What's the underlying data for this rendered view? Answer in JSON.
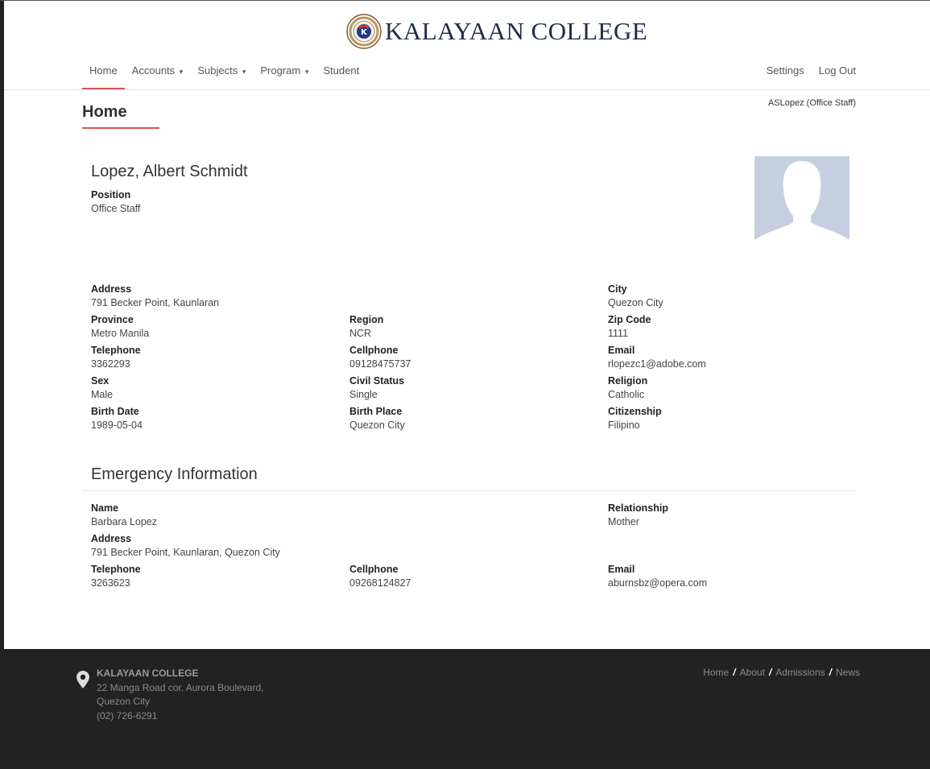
{
  "brand": {
    "name": "KALAYAAN COLLEGE",
    "logo_icon": "college-seal-logo"
  },
  "nav": {
    "left": [
      {
        "label": "Home",
        "active": true,
        "dropdown": false
      },
      {
        "label": "Accounts",
        "active": false,
        "dropdown": true
      },
      {
        "label": "Subjects",
        "active": false,
        "dropdown": true
      },
      {
        "label": "Program",
        "active": false,
        "dropdown": true
      },
      {
        "label": "Student",
        "active": false,
        "dropdown": false
      }
    ],
    "right": [
      {
        "label": "Settings"
      },
      {
        "label": "Log Out"
      }
    ],
    "dropdown_caret": "▾"
  },
  "user_tag": "ASLopez (Office Staff)",
  "page_title": "Home",
  "profile": {
    "name": "Lopez, Albert Schmidt",
    "position_label": "Position",
    "position": "Office Staff",
    "avatar_icon": "default-avatar-silhouette",
    "fields": [
      {
        "label": "Address",
        "value": "791 Becker Point, Kaunlaran"
      },
      {
        "label": "City",
        "value": "Quezon City"
      },
      {
        "label": "Province",
        "value": "Metro Manila"
      },
      {
        "label": "Region",
        "value": "NCR"
      },
      {
        "label": "Zip Code",
        "value": "1111"
      },
      {
        "label": "Telephone",
        "value": "3362293"
      },
      {
        "label": "Cellphone",
        "value": "09128475737"
      },
      {
        "label": "Email",
        "value": "rlopezc1@adobe.com"
      },
      {
        "label": "Sex",
        "value": "Male"
      },
      {
        "label": "Civil Status",
        "value": "Single"
      },
      {
        "label": "Religion",
        "value": "Catholic"
      },
      {
        "label": "Birth Date",
        "value": "1989-05-04"
      },
      {
        "label": "Birth Place",
        "value": "Quezon City"
      },
      {
        "label": "Citizenship",
        "value": "Filipino"
      }
    ]
  },
  "emergency": {
    "title": "Emergency Information",
    "fields": [
      {
        "label": "Name",
        "value": "Barbara Lopez"
      },
      {
        "label": "Relationship",
        "value": "Mother"
      },
      {
        "label": "Address",
        "value": "791 Becker Point, Kaunlaran, Quezon City"
      },
      {
        "label": "Telephone",
        "value": "3263623"
      },
      {
        "label": "Cellphone",
        "value": "09268124827"
      },
      {
        "label": "Email",
        "value": "aburnsbz@opera.com"
      }
    ]
  },
  "footer": {
    "school": "KALAYAAN COLLEGE",
    "address_line1": "22 Manga Road cor. Aurora Boulevard,",
    "address_line2": "Quezon City",
    "phone": "(02) 726-6291",
    "links": [
      "Home",
      "About",
      "Admissions",
      "News"
    ],
    "separator": "/",
    "pin_icon": "map-pin-icon"
  },
  "colors": {
    "accent": "#d9534f",
    "footer_bg": "#222222",
    "avatar_bg": "#c6cfe0",
    "brand_text": "#1c2b4a"
  }
}
